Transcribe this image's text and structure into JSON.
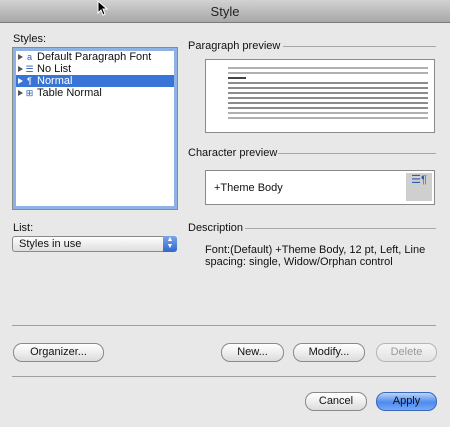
{
  "window": {
    "title": "Style"
  },
  "styles": {
    "label": "Styles:",
    "items": [
      {
        "label": "Default Paragraph Font",
        "icon": "character-style-icon",
        "selected": false
      },
      {
        "label": "No List",
        "icon": "list-style-icon",
        "selected": false
      },
      {
        "label": "Normal",
        "icon": "paragraph-style-icon",
        "selected": true
      },
      {
        "label": "Table Normal",
        "icon": "table-style-icon",
        "selected": false
      }
    ]
  },
  "list": {
    "label": "List:",
    "value": "Styles in use"
  },
  "paragraph_preview": {
    "label": "Paragraph preview"
  },
  "character_preview": {
    "label": "Character preview",
    "text": "+Theme Body"
  },
  "description": {
    "label": "Description",
    "text": "Font:(Default) +Theme Body, 12 pt, Left, Line spacing:  single, Widow/Orphan control"
  },
  "buttons": {
    "organizer": "Organizer...",
    "new": "New...",
    "modify": "Modify...",
    "delete": "Delete",
    "cancel": "Cancel",
    "apply": "Apply"
  },
  "colors": {
    "selection": "#3875d7",
    "default_button": "#4d8bf0"
  }
}
